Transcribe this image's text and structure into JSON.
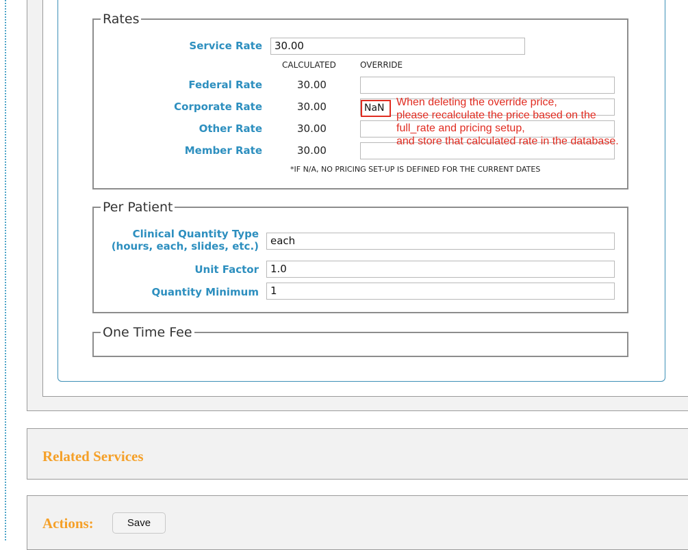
{
  "rates": {
    "legend": "Rates",
    "service_rate_label": "Service Rate",
    "service_rate_value": "30.00",
    "col_calculated": "CALCULATED",
    "col_override": "OVERRIDE",
    "rows": [
      {
        "label": "Federal Rate",
        "calculated": "30.00",
        "override": ""
      },
      {
        "label": "Corporate Rate",
        "calculated": "30.00",
        "override": "NaN"
      },
      {
        "label": "Other Rate",
        "calculated": "30.00",
        "override": ""
      },
      {
        "label": "Member Rate",
        "calculated": "30.00",
        "override": ""
      }
    ],
    "footnote": "*IF N/A, NO PRICING SET-UP IS DEFINED FOR THE CURRENT DATES"
  },
  "annotation": {
    "text": "When deleting the override price,\nplease recalculate the price based on the\nfull_rate and pricing setup,\nand store that calculated rate in the database.",
    "color": "#e02b20"
  },
  "per_patient": {
    "legend": "Per Patient",
    "clinical_qty_label_1": "Clinical Quantity Type",
    "clinical_qty_label_2": "(hours, each, slides, etc.)",
    "clinical_qty_value": "each",
    "unit_factor_label": "Unit Factor",
    "unit_factor_value": "1.0",
    "qty_min_label": "Quantity Minimum",
    "qty_min_value": "1"
  },
  "one_time_fee": {
    "legend": "One Time Fee"
  },
  "related_services": {
    "title": "Related Services"
  },
  "actions": {
    "title": "Actions:",
    "save_label": "Save"
  },
  "colors": {
    "label_blue": "#2d8fbf",
    "section_orange": "#f5a028",
    "annotation_red": "#e02b20"
  }
}
